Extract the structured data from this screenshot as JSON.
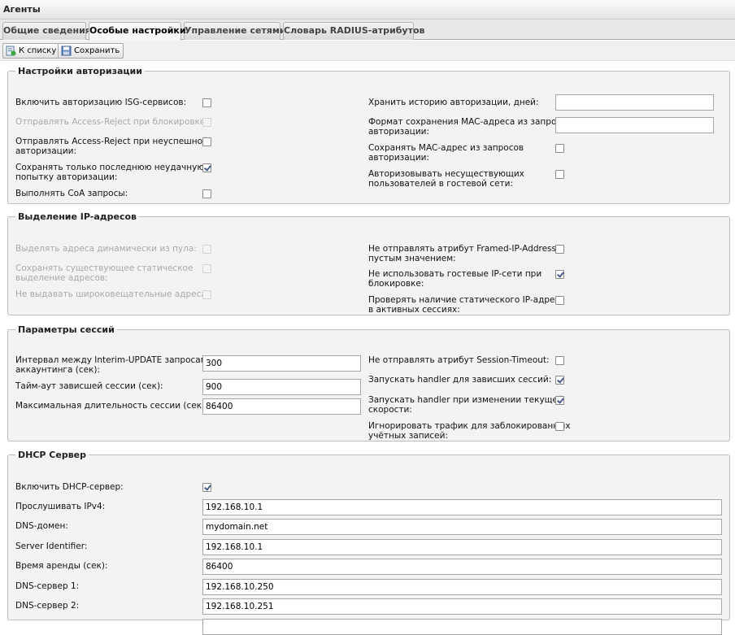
{
  "window": {
    "title": "Агенты"
  },
  "tabs": [
    {
      "label": "Общие сведения"
    },
    {
      "label": "Особые настройки"
    },
    {
      "label": "Управление сетями"
    },
    {
      "label": "Словарь RADIUS-атрибутов"
    }
  ],
  "toolbar": {
    "back_label": "К списку",
    "save_label": "Сохранить"
  },
  "auth": {
    "title": "Настройки авторизации",
    "isg": {
      "label": "Включить авторизацию ISG-сервисов:",
      "checked": false,
      "disabled": false
    },
    "reject_block": {
      "label": "Отправлять Access-Reject при блокировке:",
      "checked": false,
      "disabled": true
    },
    "reject_fail": {
      "label1": "Отправлять Access-Reject при неуспешной",
      "label2": "авторизации:",
      "checked": false,
      "disabled": false
    },
    "save_last": {
      "label1": "Сохранять только последнюю неудачную",
      "label2": "попытку авторизации:",
      "checked": true,
      "disabled": false
    },
    "coa": {
      "label": "Выполнять CoA запросы:",
      "checked": false,
      "disabled": false
    },
    "history": {
      "label": "Хранить историю авторизации, дней:",
      "value": ""
    },
    "mac_format": {
      "label1": "Формат сохранения MAC-адреса из запросов",
      "label2": "авторизации:",
      "value": ""
    },
    "save_mac": {
      "label1": "Сохранять MAC-адрес из запросов",
      "label2": "авторизации:",
      "checked": false
    },
    "guest_auth": {
      "label1": "Авторизовывать несуществующих",
      "label2": "пользователей в гостевой сети:",
      "checked": false
    }
  },
  "ip": {
    "title": "Выделение IP-адресов",
    "dynamic": {
      "label": "Выделять адреса динамически из пула:",
      "checked": false,
      "disabled": true
    },
    "keep_static": {
      "label1": "Сохранять существующее статическое",
      "label2": "выделение адресов:",
      "checked": false,
      "disabled": true
    },
    "no_broadcast": {
      "label": "Не выдавать широковещательные адреса:",
      "checked": false,
      "disabled": true
    },
    "no_framed": {
      "label1": "Не отправлять атрибут Framed-IP-Address с",
      "label2": "пустым значением:",
      "checked": false
    },
    "no_guest": {
      "label1": "Не использовать гостевые IP-сети при",
      "label2": "блокировке:",
      "checked": true
    },
    "check_static": {
      "label1": "Проверять наличие статического IP-адреса",
      "label2": "в активных сессиях:",
      "checked": false
    }
  },
  "session": {
    "title": "Параметры сессий",
    "interim": {
      "label1": "Интервал между Interim-UPDATE запросами",
      "label2": "аккаунтинга (сек):",
      "value": "300"
    },
    "hang_timeout": {
      "label": "Тайм-аут зависшей сессии (сек):",
      "value": "900"
    },
    "max_duration": {
      "label": "Максимальная длительность сессии (сек):",
      "value": "86400"
    },
    "no_timeout": {
      "label": "Не отправлять атрибут Session-Timeout:",
      "checked": false
    },
    "handler_hang": {
      "label": "Запускать handler для зависших сессий:",
      "checked": true
    },
    "handler_change": {
      "label1": "Запускать handler при изменении текущей",
      "label2": "скорости:",
      "checked": true
    },
    "ignore_blocked": {
      "label1": "Игнорировать трафик для заблокированных",
      "label2": "учётных записей:",
      "checked": false
    }
  },
  "dhcp": {
    "title": "DHCP Сервер",
    "enable": {
      "label": "Включить DHCP-сервер:",
      "checked": true
    },
    "listen": {
      "label": "Прослушивать IPv4:",
      "value": "192.168.10.1"
    },
    "domain": {
      "label": "DNS-домен:",
      "value": "mydomain.net"
    },
    "server_id": {
      "label": "Server Identifier:",
      "value": "192.168.10.1"
    },
    "lease": {
      "label": "Время аренды (сек):",
      "value": "86400"
    },
    "dns1": {
      "label": "DNS-сервер 1:",
      "value": "192.168.10.250"
    },
    "dns2": {
      "label": "DNS-сервер 2:",
      "value": "192.168.10.251"
    }
  }
}
